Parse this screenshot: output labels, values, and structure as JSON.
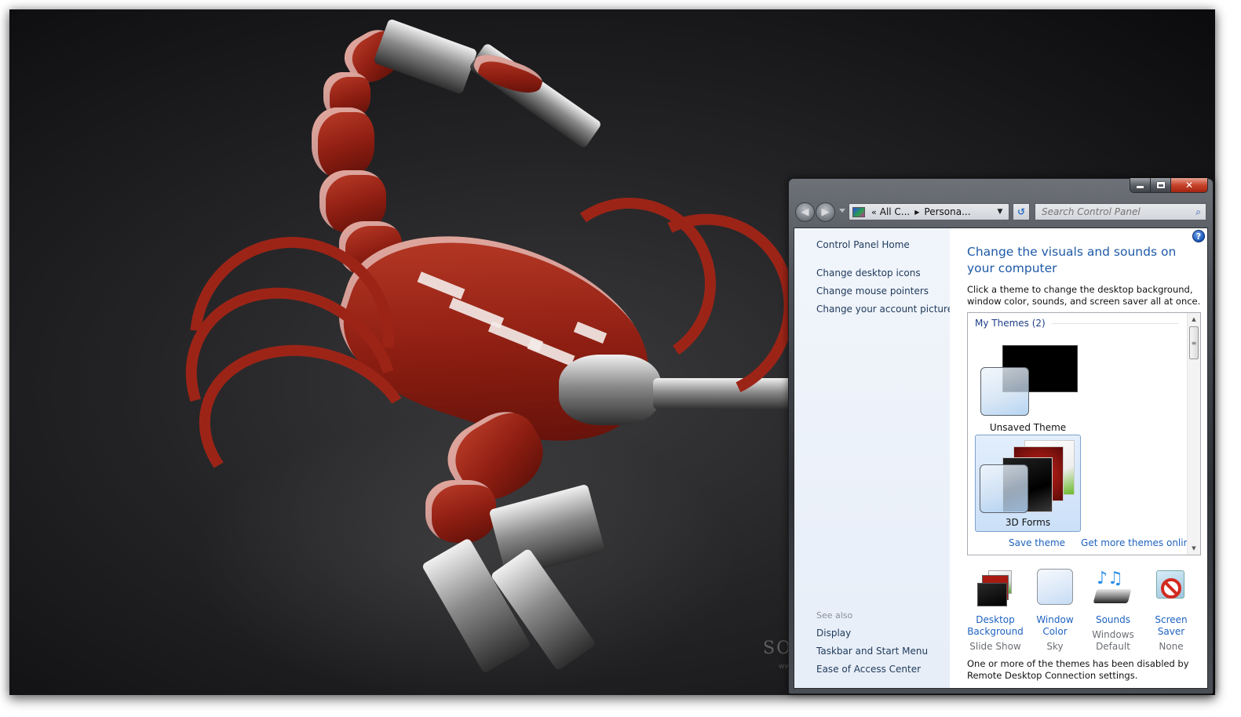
{
  "desktop": {
    "wallpaper": "3D red mechanical scorpion",
    "watermark": "SOFTPEDIA",
    "watermark_url": "www.softpedia.com"
  },
  "window": {
    "caption_buttons": {
      "minimize": "minimize-icon",
      "maximize": "maximize-icon",
      "close": "close-icon"
    },
    "nav": {
      "back_icon": "back-arrow-icon",
      "forward_icon": "forward-arrow-icon"
    },
    "address": {
      "overflow": "«",
      "crumbs": [
        "All C...",
        "Persona..."
      ],
      "separator": "▶",
      "dropdown": "▼"
    },
    "refresh_icon": "↺",
    "search": {
      "placeholder": "Search Control Panel",
      "icon": "⌕"
    }
  },
  "left_pane": {
    "home_link": "Control Panel Home",
    "tasks": [
      "Change desktop icons",
      "Change mouse pointers",
      "Change your account picture"
    ],
    "see_also_title": "See also",
    "see_also": [
      "Display",
      "Taskbar and Start Menu",
      "Ease of Access Center"
    ]
  },
  "main": {
    "help_icon": "?",
    "title": "Change the visuals and sounds on your computer",
    "description": "Click a theme to change the desktop background, window color, sounds, and screen saver all at once.",
    "themes_group": "My Themes (2)",
    "themes": [
      {
        "name": "Unsaved Theme",
        "selected": false
      },
      {
        "name": "3D Forms",
        "selected": true
      }
    ],
    "links": {
      "save": "Save theme",
      "more": "Get more themes online"
    },
    "scrollbar": {
      "up": "▲",
      "down": "▼",
      "grip": "≡"
    },
    "settings": [
      {
        "name": "Desktop Background",
        "value": "Slide Show"
      },
      {
        "name": "Window Color",
        "value": "Sky"
      },
      {
        "name": "Sounds",
        "value": "Windows Default"
      },
      {
        "name": "Screen Saver",
        "value": "None"
      }
    ],
    "footer": "One or more of the themes has been disabled by Remote Desktop Connection settings."
  }
}
